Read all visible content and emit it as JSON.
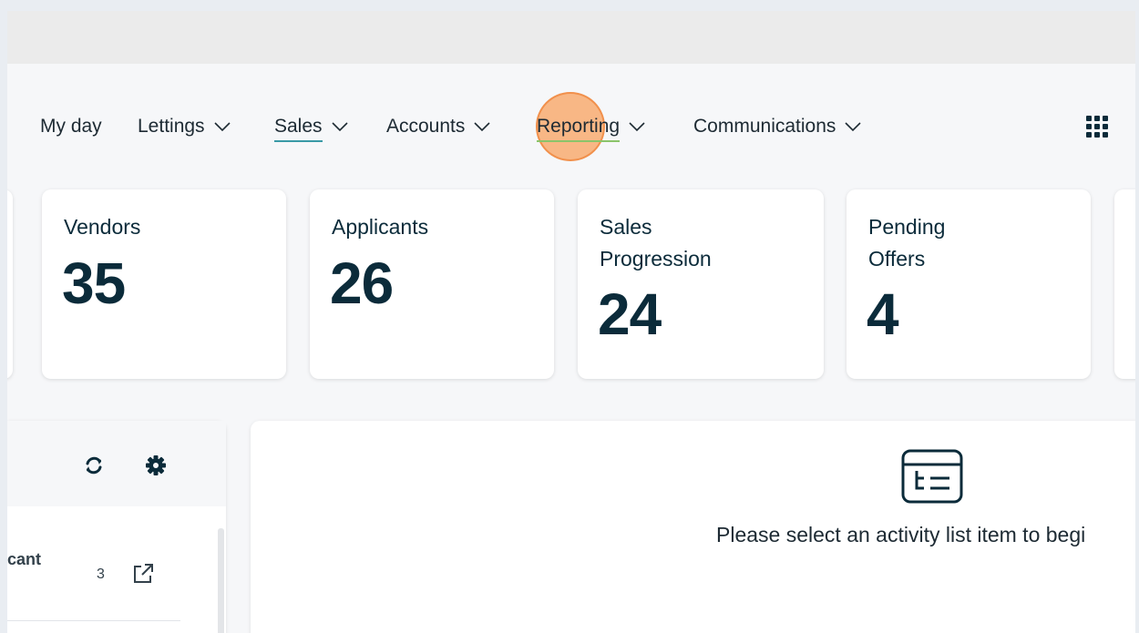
{
  "nav": {
    "items": [
      {
        "label": "My day",
        "has_dropdown": false,
        "active": false
      },
      {
        "label": "Lettings",
        "has_dropdown": true,
        "active": false
      },
      {
        "label": "Sales",
        "has_dropdown": true,
        "active": true
      },
      {
        "label": "Accounts",
        "has_dropdown": true,
        "active": false
      },
      {
        "label": "Reporting",
        "has_dropdown": true,
        "active": false,
        "highlighted": true
      },
      {
        "label": "Communications",
        "has_dropdown": true,
        "active": false
      }
    ],
    "apps_icon": "grid-icon",
    "active_underline_color": "#3a9aa6",
    "highlight_color": "#f89e58"
  },
  "stats": {
    "cards": [
      {
        "label": "Vendors",
        "value": "35"
      },
      {
        "label": "Applicants",
        "value": "26"
      },
      {
        "label": "Sales Progression",
        "value": "24"
      },
      {
        "label": "Pending Offers",
        "value": "4"
      }
    ]
  },
  "activity_list": {
    "refresh_icon": "refresh-icon",
    "settings_icon": "gear-icon",
    "rows": [
      {
        "label": "cant",
        "count": "3",
        "icon": "external-link-icon"
      }
    ]
  },
  "detail_panel": {
    "icon": "list-icon",
    "message": "Please select an activity list item to begi"
  }
}
